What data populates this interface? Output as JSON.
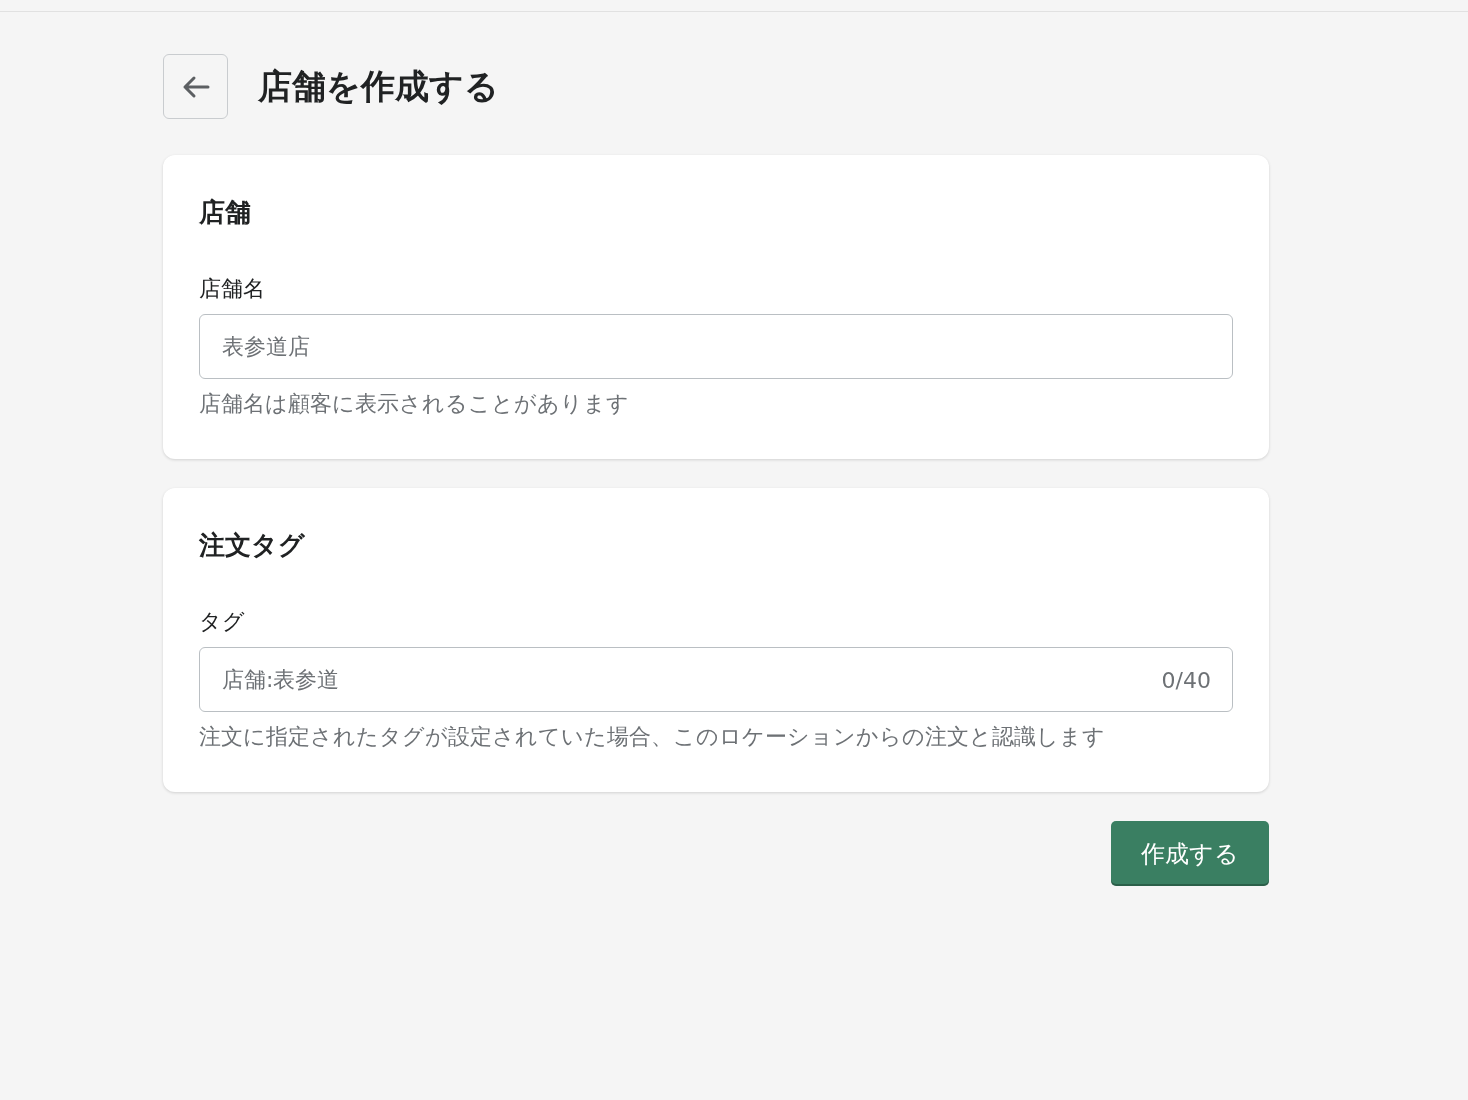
{
  "header": {
    "title": "店舗を作成する"
  },
  "sections": [
    {
      "title": "店舗",
      "label": "店舗名",
      "placeholder": "表参道店",
      "help": "店舗名は顧客に表示されることがあります"
    },
    {
      "title": "注文タグ",
      "label": "タグ",
      "placeholder": "店舗:表参道",
      "counter": "0/40",
      "help": "注文に指定されたタグが設定されていた場合、このロケーションからの注文と認識します"
    }
  ],
  "submit_button": "作成する"
}
